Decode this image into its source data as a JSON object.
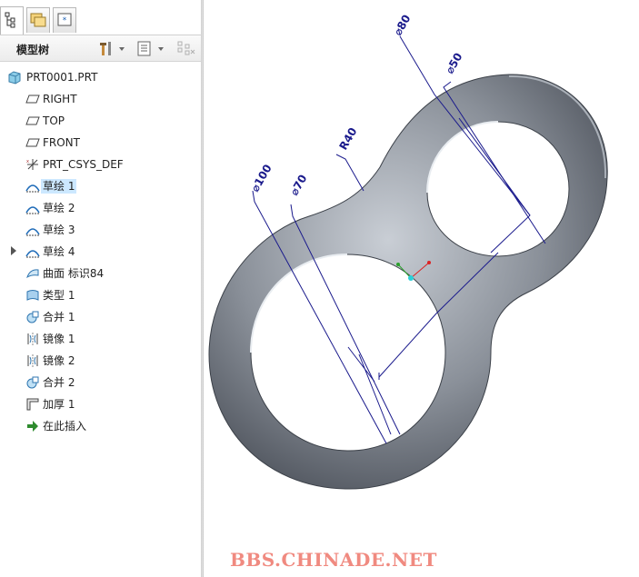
{
  "panel": {
    "title": "模型树",
    "tabs": [
      {
        "icon": "model-tree-tab-icon"
      },
      {
        "icon": "folder-browser-tab-icon"
      },
      {
        "icon": "favorites-tab-icon"
      }
    ],
    "tools": [
      "settings-icon",
      "dropdown-arrow-icon",
      "show-icon",
      "dropdown-arrow-icon",
      "columns-icon"
    ]
  },
  "tree": {
    "root": "PRT0001.PRT",
    "items": [
      {
        "label": "RIGHT",
        "icon": "datum-plane-icon"
      },
      {
        "label": "TOP",
        "icon": "datum-plane-icon"
      },
      {
        "label": "FRONT",
        "icon": "datum-plane-icon"
      },
      {
        "label": "PRT_CSYS_DEF",
        "icon": "csys-icon"
      },
      {
        "label": "草绘 1",
        "icon": "sketch-icon",
        "selected": true
      },
      {
        "label": "草绘 2",
        "icon": "sketch-icon"
      },
      {
        "label": "草绘 3",
        "icon": "sketch-icon"
      },
      {
        "label": "草绘 4",
        "icon": "sketch-icon",
        "expandable": true
      },
      {
        "label": "曲面 标识84",
        "icon": "surface-icon"
      },
      {
        "label": "类型 1",
        "icon": "boundary-blend-icon"
      },
      {
        "label": "合并 1",
        "icon": "merge-icon"
      },
      {
        "label": "镜像 1",
        "icon": "mirror-icon"
      },
      {
        "label": "镜像 2",
        "icon": "mirror-icon"
      },
      {
        "label": "合并 2",
        "icon": "merge-icon"
      },
      {
        "label": "加厚 1",
        "icon": "thicken-icon"
      },
      {
        "label": "在此插入",
        "icon": "insert-here-icon"
      }
    ]
  },
  "viewport": {
    "dimensions": {
      "d80": "80",
      "d50": "50",
      "r40": "R40",
      "d100": "100",
      "d70": "70"
    },
    "diameter_symbol": "⌀",
    "body_color": "#8a9099",
    "dimension_color": "#1a1a8c"
  },
  "watermark": "BBS.CHINADE.NET"
}
